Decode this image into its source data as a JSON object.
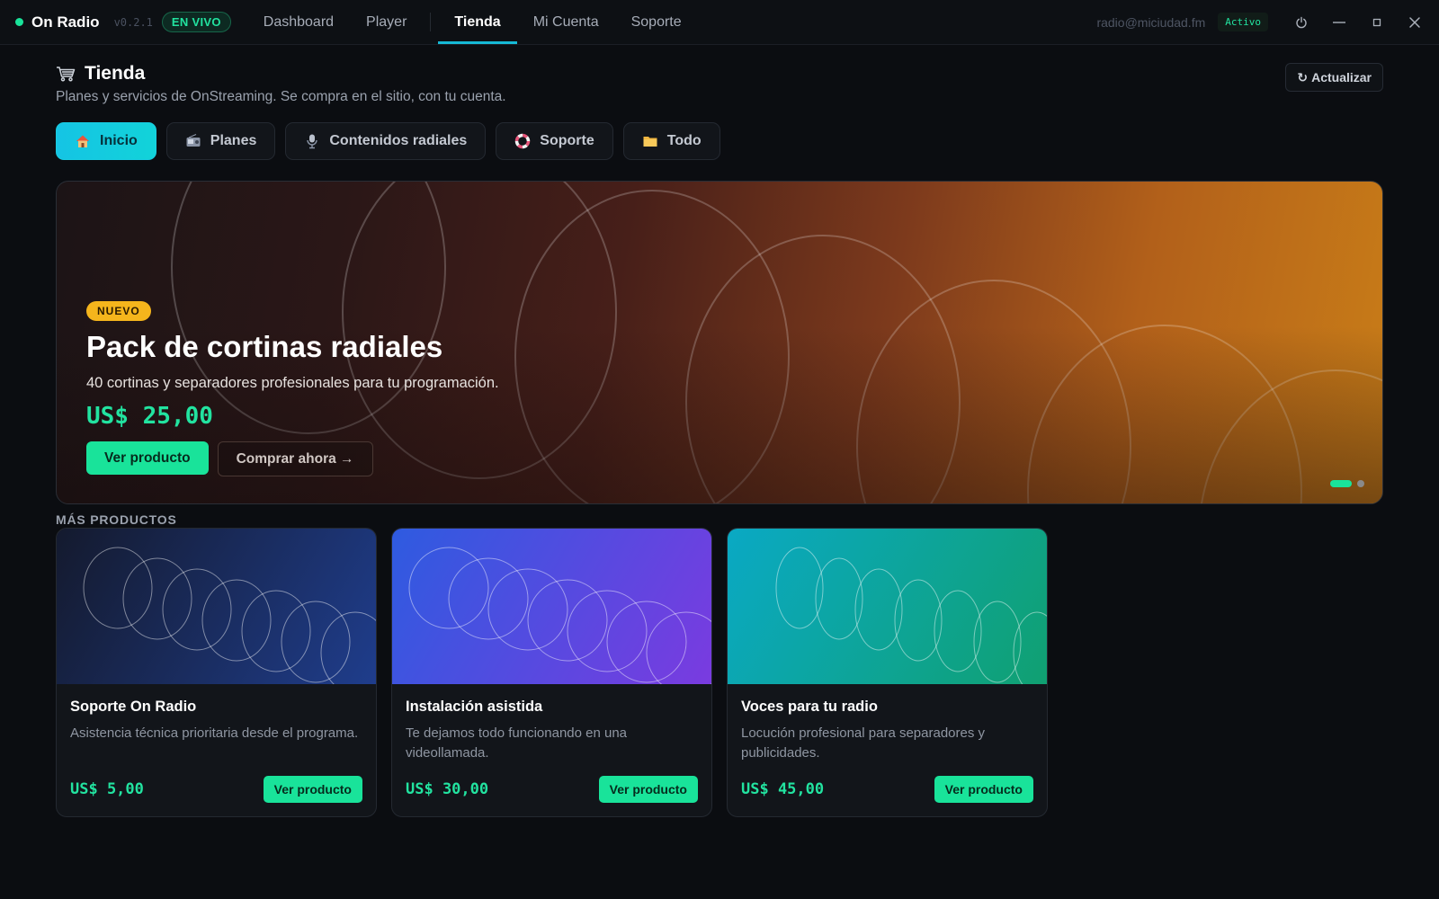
{
  "app": {
    "name": "On Radio",
    "version": "v0.2.1",
    "live_badge": "EN VIVO",
    "live_color": "#19e39a"
  },
  "nav": {
    "items": [
      {
        "label": "Dashboard"
      },
      {
        "label": "Player"
      },
      {
        "label": "Tienda",
        "active": true
      },
      {
        "label": "Mi Cuenta"
      },
      {
        "label": "Soporte"
      }
    ]
  },
  "account": {
    "email": "radio@miciudad.fm",
    "status": "Activo"
  },
  "window_controls": [
    "power-icon",
    "minimize-icon",
    "maximize-icon",
    "close-icon"
  ],
  "page": {
    "icon": "cart-icon",
    "title": "Tienda",
    "subtitle": "Planes y servicios de OnStreaming. Se compra en el sitio, con tu cuenta.",
    "refresh_label": "Actualizar",
    "refresh_glyph": "↻"
  },
  "categories": [
    {
      "label": "Inicio",
      "icon": "house-icon",
      "active": true
    },
    {
      "label": "Planes",
      "icon": "radio-icon"
    },
    {
      "label": "Contenidos radiales",
      "icon": "microphone-icon"
    },
    {
      "label": "Soporte",
      "icon": "lifebuoy-icon"
    },
    {
      "label": "Todo",
      "icon": "folder-icon"
    }
  ],
  "hero": {
    "badge": "NUEVO",
    "title": "Pack de cortinas radiales",
    "description": "40 cortinas y separadores profesionales para tu programación.",
    "price": "US$ 25,00",
    "primary_action": "Ver producto",
    "secondary_action": "Comprar ahora →",
    "slides": 2,
    "active_slide": 1
  },
  "more": {
    "label": "MÁS PRODUCTOS",
    "products": [
      {
        "title": "Soporte On Radio",
        "description": "Asistencia técnica prioritaria desde el programa.",
        "price": "US$ 5,00",
        "action": "Ver producto",
        "colors": [
          "#141a2e",
          "#1f3d8c"
        ]
      },
      {
        "title": "Instalación asistida",
        "description": "Te dejamos todo funcionando en una videollamada.",
        "price": "US$ 30,00",
        "action": "Ver producto",
        "colors": [
          "#2e5be0",
          "#7a3be0"
        ]
      },
      {
        "title": "Voces para tu radio",
        "description": "Locución profesional para separadores y publicidades.",
        "price": "US$ 45,00",
        "action": "Ver producto",
        "colors": [
          "#0aa9c4",
          "#10a071"
        ]
      }
    ]
  },
  "colors": {
    "accent": "#19e39a",
    "tab_active": "#16c6e2",
    "badge": "#f5b51c",
    "background": "#0b0d11"
  }
}
